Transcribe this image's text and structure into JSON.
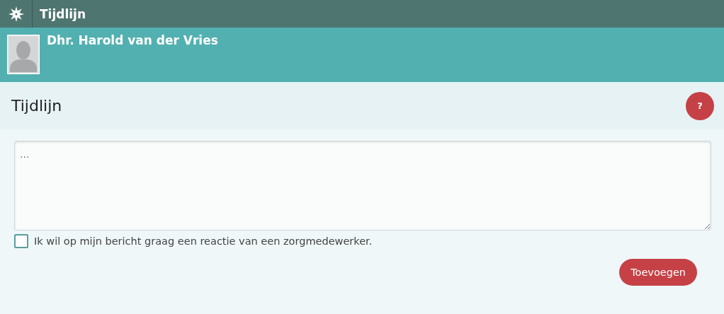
{
  "top_bar": {
    "title": "Tijdlijn"
  },
  "profile": {
    "name": "Dhr. Harold van der Vries"
  },
  "page": {
    "title": "Tijdlijn",
    "help_button": "?"
  },
  "message": {
    "placeholder": "...",
    "reply_request": {
      "label": "Ik wil op mijn bericht graag een reactie van een zorgmedewerker.",
      "checked": false
    },
    "submit": "Toevoegen"
  }
}
